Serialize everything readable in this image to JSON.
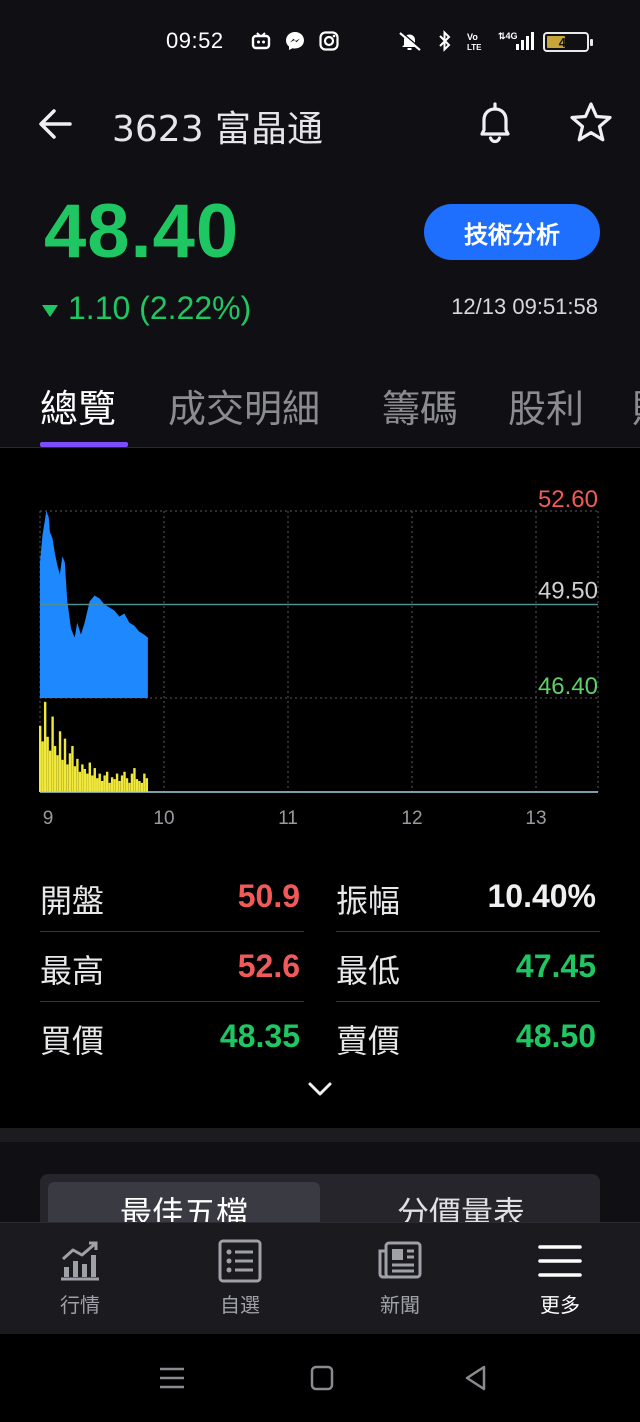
{
  "status_bar": {
    "time": "09:52",
    "left_icons": [
      "tv-app-icon",
      "messenger-icon",
      "instagram-icon"
    ],
    "right_icons": [
      "mute-icon",
      "bluetooth-icon",
      "volte-icon",
      "signal-icon"
    ],
    "battery": "44",
    "battery_level_percent": 44
  },
  "header": {
    "title": "3623 富晶通"
  },
  "quote": {
    "price": "48.40",
    "change": "1.10 (2.22%)",
    "direction": "down",
    "technical_button": "技術分析",
    "timestamp": "12/13 09:51:58"
  },
  "tabs": [
    {
      "label": "總覽",
      "active": true
    },
    {
      "label": "成交明細",
      "active": false
    },
    {
      "label": "籌碼",
      "active": false
    },
    {
      "label": "股利",
      "active": false
    }
  ],
  "chart_data": {
    "type": "area",
    "y_labels": {
      "high": "52.60",
      "mid": "49.50",
      "low": "46.40"
    },
    "ylim": [
      46.4,
      52.6
    ],
    "reference_price": 49.5,
    "x_ticks": [
      "9",
      "10",
      "11",
      "12",
      "13"
    ],
    "xlim": [
      9,
      13.5
    ],
    "price_series": {
      "x": [
        9.0,
        9.02,
        9.04,
        9.05,
        9.07,
        9.08,
        9.1,
        9.12,
        9.14,
        9.16,
        9.18,
        9.2,
        9.22,
        9.25,
        9.28,
        9.3,
        9.33,
        9.36,
        9.4,
        9.44,
        9.48,
        9.52,
        9.56,
        9.6,
        9.64,
        9.68,
        9.72,
        9.76,
        9.8,
        9.84,
        9.87
      ],
      "y": [
        50.9,
        51.8,
        52.3,
        52.6,
        52.4,
        51.9,
        51.7,
        51.2,
        50.8,
        50.5,
        51.1,
        50.9,
        49.6,
        48.7,
        48.4,
        48.9,
        48.5,
        48.9,
        49.6,
        49.8,
        49.7,
        49.5,
        49.4,
        49.3,
        49.1,
        49.2,
        48.9,
        48.8,
        48.6,
        48.5,
        48.4
      ]
    },
    "volume_series": {
      "x": [
        9.0,
        9.02,
        9.04,
        9.06,
        9.08,
        9.1,
        9.12,
        9.14,
        9.16,
        9.18,
        9.2,
        9.22,
        9.24,
        9.26,
        9.28,
        9.3,
        9.32,
        9.34,
        9.36,
        9.38,
        9.4,
        9.42,
        9.44,
        9.46,
        9.48,
        9.5,
        9.52,
        9.54,
        9.56,
        9.58,
        9.6,
        9.62,
        9.64,
        9.66,
        9.68,
        9.7,
        9.72,
        9.74,
        9.76,
        9.78,
        9.8,
        9.82,
        9.84,
        9.86
      ],
      "v": [
        0.72,
        0.55,
        0.98,
        0.6,
        0.45,
        0.82,
        0.5,
        0.4,
        0.66,
        0.35,
        0.58,
        0.3,
        0.42,
        0.5,
        0.28,
        0.36,
        0.22,
        0.3,
        0.25,
        0.2,
        0.32,
        0.18,
        0.26,
        0.15,
        0.2,
        0.12,
        0.18,
        0.22,
        0.1,
        0.16,
        0.14,
        0.2,
        0.12,
        0.18,
        0.22,
        0.15,
        0.1,
        0.2,
        0.26,
        0.14,
        0.12,
        0.1,
        0.2,
        0.15
      ]
    },
    "colors": {
      "price_fill": "#1e88ff",
      "volume": "#f0e83a",
      "ref_line": "#4d8f8f",
      "high": "#f25a5a",
      "low": "#5fd06a",
      "mid": "#cfcfcf"
    }
  },
  "stats": [
    [
      {
        "label": "開盤",
        "value": "50.9",
        "color": "red"
      },
      {
        "label": "振幅",
        "value": "10.40%",
        "color": "white"
      }
    ],
    [
      {
        "label": "最高",
        "value": "52.6",
        "color": "red"
      },
      {
        "label": "最低",
        "value": "47.45",
        "color": "green"
      }
    ],
    [
      {
        "label": "買價",
        "value": "48.35",
        "color": "green"
      },
      {
        "label": "賣價",
        "value": "48.50",
        "color": "green"
      }
    ]
  ],
  "segment": {
    "active": "最佳五檔",
    "inactive": "分價量表"
  },
  "bottom_nav": [
    {
      "label": "行情",
      "icon": "chart-icon",
      "active": false
    },
    {
      "label": "自選",
      "icon": "list-icon",
      "active": false
    },
    {
      "label": "新聞",
      "icon": "news-icon",
      "active": false
    },
    {
      "label": "更多",
      "icon": "menu-icon",
      "active": true
    }
  ]
}
